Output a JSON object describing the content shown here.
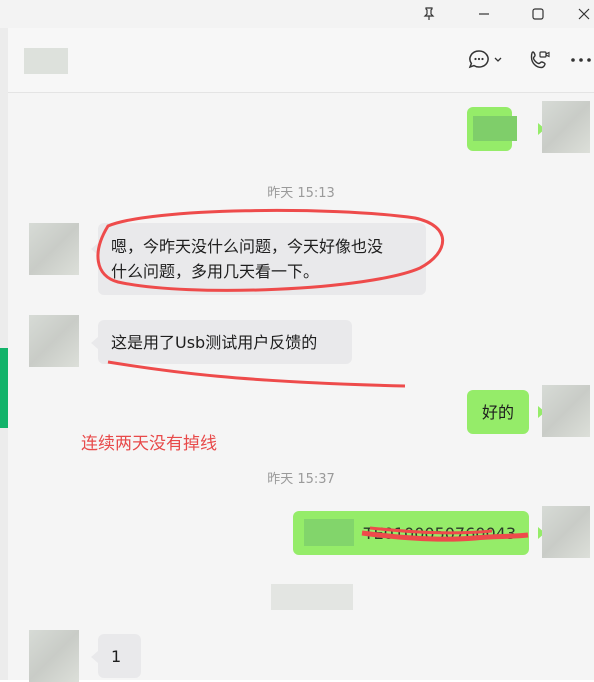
{
  "window": {
    "pin_icon": "pin-icon",
    "minimize_icon": "minimize-icon",
    "maximize_icon": "maximize-icon",
    "close_icon": "close-icon"
  },
  "header": {
    "chat_icon": "chat-bubble-icon",
    "call_icon": "video-call-icon",
    "more_icon": "more-icon"
  },
  "messages": {
    "time1": "昨天 15:13",
    "msg1_line1": "嗯，今昨天没什么问题，今天好像也没",
    "msg1_line2": "什么问题，多用几天看一下。",
    "msg2": "这是用了Usb测试用户反馈的",
    "reply_ok": "好的",
    "annotation": "连续两天没有掉线",
    "time2": "昨天 15:37",
    "number_msg": "TE0100050760043",
    "msg_last": "1"
  },
  "colors": {
    "accent": "#12b36a",
    "bubble_self": "#95ec69",
    "annotation_red": "#e84a4a"
  }
}
